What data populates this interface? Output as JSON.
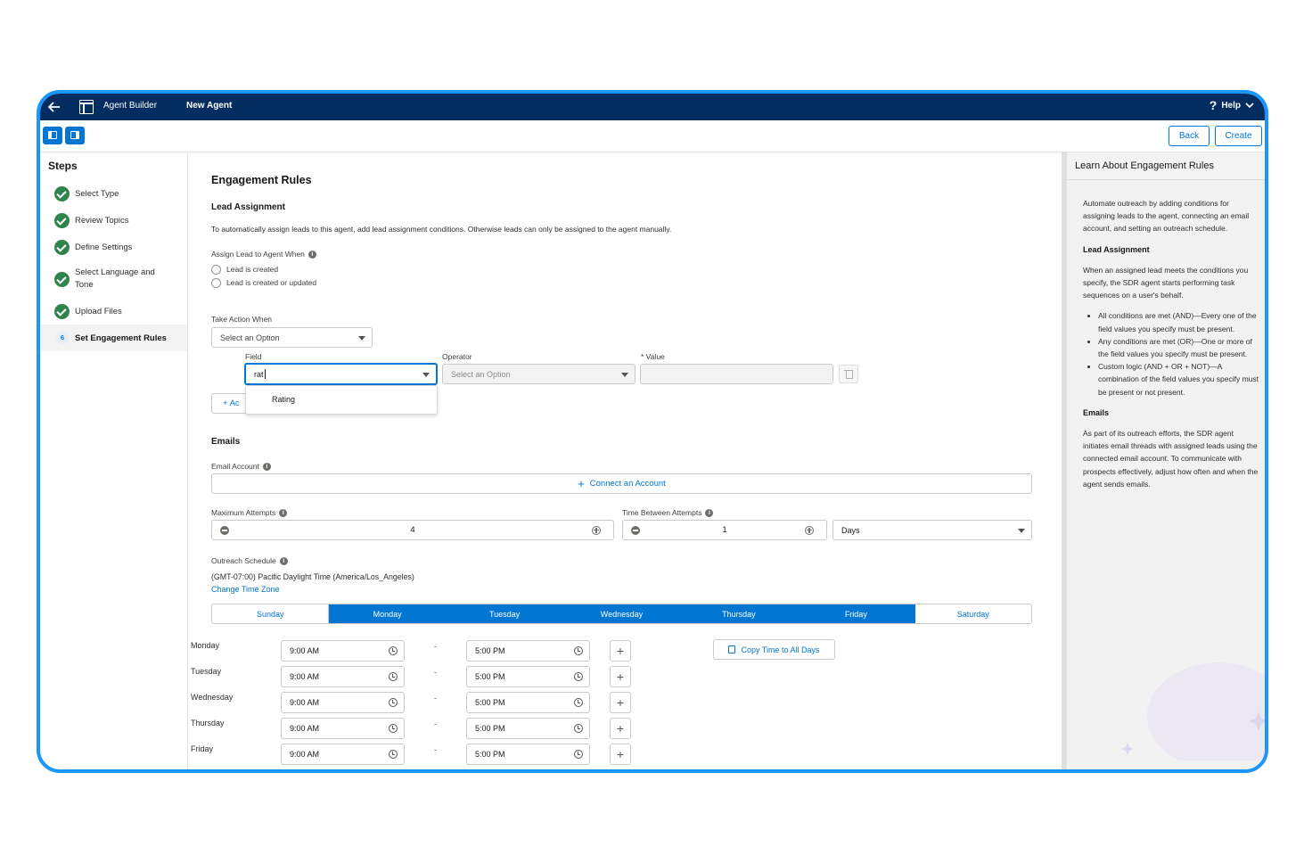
{
  "header": {
    "app_name": "Agent Builder",
    "page_title": "New Agent",
    "help_label": "Help"
  },
  "toolbar": {
    "back_label": "Back",
    "create_label": "Create"
  },
  "steps": {
    "title": "Steps",
    "items": [
      {
        "label": "Select Type",
        "status": "complete"
      },
      {
        "label": "Review Topics",
        "status": "complete"
      },
      {
        "label": "Define Settings",
        "status": "complete"
      },
      {
        "label": "Select Language and Tone",
        "status": "complete"
      },
      {
        "label": "Upload Files",
        "status": "complete"
      },
      {
        "label": "Set Engagement Rules",
        "status": "current",
        "number": "6"
      }
    ]
  },
  "main": {
    "title": "Engagement Rules",
    "lead_assignment": {
      "heading": "Lead Assignment",
      "description": "To automatically assign leads to this agent, add lead assignment conditions. Otherwise leads can only be assigned to the agent manually.",
      "assign_label": "Assign Lead to Agent When",
      "radio_created": "Lead is created",
      "radio_created_updated": "Lead is created or updated",
      "take_action_label": "Take Action When",
      "take_action_value": "Select an Option",
      "field_label": "Field",
      "field_value": "rat",
      "field_suggestion": "Rating",
      "operator_label": "Operator",
      "operator_value": "Select an Option",
      "value_label": "* Value",
      "add_label": "+ Ac"
    },
    "emails": {
      "heading": "Emails",
      "account_label": "Email Account",
      "connect_label": "Connect an Account",
      "max_attempts_label": "Maximum Attempts",
      "max_attempts_value": "4",
      "time_between_label": "Time Between Attempts",
      "time_between_value": "1",
      "time_unit": "Days",
      "schedule_label": "Outreach Schedule",
      "timezone": "(GMT-07:00) Pacific Daylight Time (America/Los_Angeles)",
      "change_tz": "Change Time Zone",
      "day_tabs": [
        {
          "label": "Sunday",
          "selected": false
        },
        {
          "label": "Monday",
          "selected": true
        },
        {
          "label": "Tuesday",
          "selected": true
        },
        {
          "label": "Wednesday",
          "selected": true
        },
        {
          "label": "Thursday",
          "selected": true
        },
        {
          "label": "Friday",
          "selected": true
        },
        {
          "label": "Saturday",
          "selected": false
        }
      ],
      "schedule": [
        {
          "day": "Monday",
          "start": "9:00 AM",
          "end": "5:00 PM"
        },
        {
          "day": "Tuesday",
          "start": "9:00 AM",
          "end": "5:00 PM"
        },
        {
          "day": "Wednesday",
          "start": "9:00 AM",
          "end": "5:00 PM"
        },
        {
          "day": "Thursday",
          "start": "9:00 AM",
          "end": "5:00 PM"
        },
        {
          "day": "Friday",
          "start": "9:00 AM",
          "end": "5:00 PM"
        }
      ],
      "copy_label": "Copy Time to All Days",
      "separator": "-"
    }
  },
  "help_panel": {
    "title": "Learn About Engagement Rules",
    "intro": "Automate outreach by adding conditions for assigning leads to the agent, connecting an email account, and setting an outreach schedule.",
    "lead_heading": "Lead Assignment",
    "lead_text": "When an assigned lead meets the conditions you specify, the SDR agent starts performing task sequences on a user's behalf.",
    "bullets": [
      "All conditions are met (AND)—Every one of the field values you specify must be present.",
      "Any conditions are met (OR)—One or more of the field values you specify must be present.",
      "Custom logic (AND + OR + NOT)—A combination of the field values you specify must be present or not present."
    ],
    "emails_heading": "Emails",
    "emails_text": "As part of its outreach efforts, the SDR agent initiates email threads with assigned leads using the connected email account. To communicate with prospects effectively, adjust how often and when the agent sends emails."
  },
  "colors": {
    "nav_bg": "#032d60",
    "brand_blue": "#0176d3",
    "frame_blue": "#1b96ff",
    "success_green": "#2e844a"
  }
}
